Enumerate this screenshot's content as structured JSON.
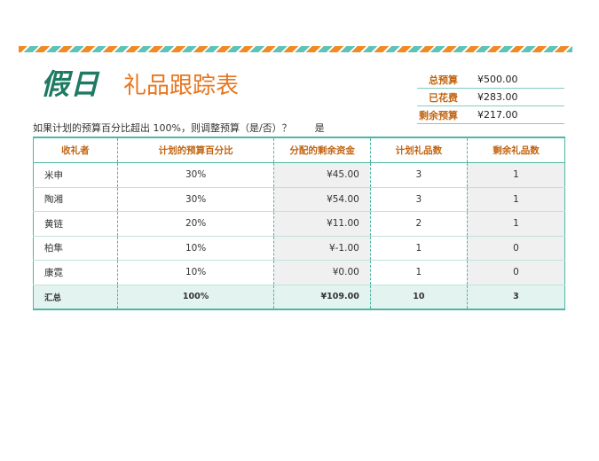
{
  "banner": {
    "stripe_colors": [
      "#f08a24",
      "#5fc2b6"
    ]
  },
  "title": {
    "main": "假日",
    "sub": "礼品跟踪表"
  },
  "summary": {
    "rows": [
      {
        "label": "总预算",
        "value": "¥500.00"
      },
      {
        "label": "已花费",
        "value": "¥283.00"
      },
      {
        "label": "剩余预算",
        "value": "¥217.00"
      }
    ]
  },
  "note": {
    "question": "如果计划的预算百分比超出 100%，则调整预算（是/否）？",
    "answer": "是"
  },
  "table": {
    "headers": [
      "收礼者",
      "计划的预算百分比",
      "分配的剩余资金",
      "计划礼品数",
      "剩余礼品数"
    ],
    "rows": [
      [
        "米申",
        "30%",
        "¥45.00",
        "3",
        "1"
      ],
      [
        "陶湘",
        "30%",
        "¥54.00",
        "3",
        "1"
      ],
      [
        "黄链",
        "20%",
        "¥11.00",
        "2",
        "1"
      ],
      [
        "柏隼",
        "10%",
        "¥-1.00",
        "1",
        "0"
      ],
      [
        "康霓",
        "10%",
        "¥0.00",
        "1",
        "0"
      ]
    ],
    "total": [
      "汇总",
      "100%",
      "¥109.00",
      "10",
      "3"
    ]
  },
  "colors": {
    "accent_green": "#1e7a62",
    "accent_orange": "#e8761f",
    "teal_border": "#4fb6a6"
  }
}
